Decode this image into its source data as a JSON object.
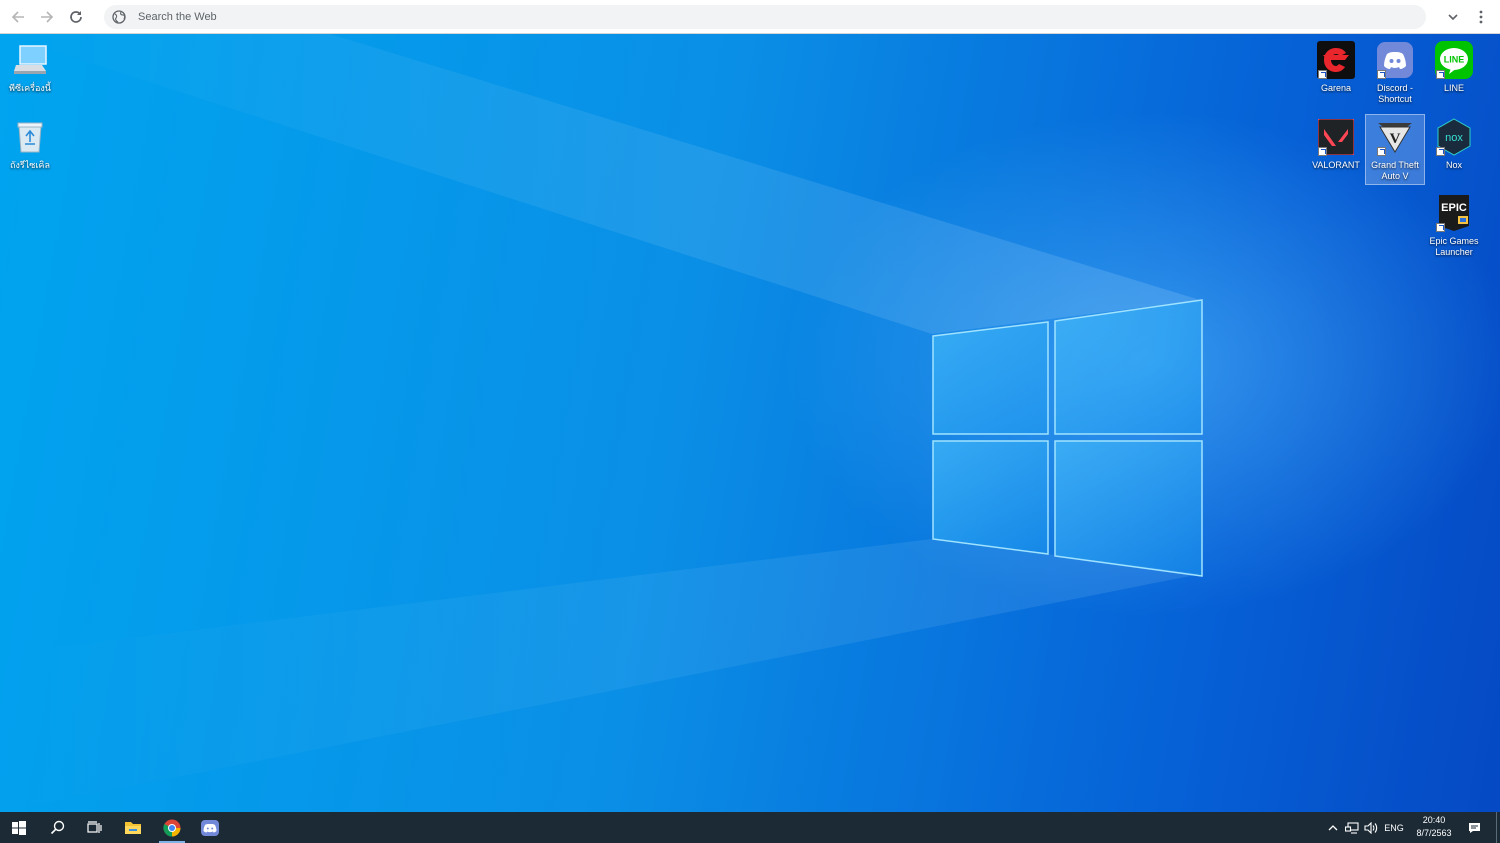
{
  "browser": {
    "omnibox_placeholder": "Search the Web",
    "icons": {
      "back": "arrow-left-icon",
      "forward": "arrow-right-icon",
      "reload": "reload-icon",
      "site_info": "globe-icon",
      "tab_search": "chevron-down-icon",
      "menu": "kebab-menu-icon"
    }
  },
  "desktop": {
    "left_icons": [
      {
        "label": "พีซีเครื่องนี้",
        "icon": "this-pc-icon"
      },
      {
        "label": "ถังรีไซเคิล",
        "icon": "recycle-bin-icon"
      }
    ],
    "right_icons": [
      {
        "label": "Garena",
        "icon": "garena-icon"
      },
      {
        "label": "Discord - Shortcut",
        "icon": "discord-icon"
      },
      {
        "label": "LINE",
        "icon": "line-icon",
        "badge": "LINE"
      },
      {
        "label": "VALORANT",
        "icon": "valorant-icon"
      },
      {
        "label": "Grand Theft Auto V",
        "icon": "gta-v-icon",
        "badge": "V",
        "selected": true
      },
      {
        "label": "Nox",
        "icon": "nox-icon",
        "badge": "nox"
      },
      {
        "label": "Epic Games Launcher",
        "icon": "epic-games-icon",
        "badge": "EPIC"
      }
    ]
  },
  "taskbar": {
    "items": [
      {
        "name": "start",
        "icon": "windows-start-icon"
      },
      {
        "name": "search",
        "icon": "search-icon"
      },
      {
        "name": "task-view",
        "icon": "task-view-icon"
      },
      {
        "name": "file-explorer",
        "icon": "folder-icon"
      },
      {
        "name": "chrome",
        "icon": "chrome-icon",
        "active": true
      },
      {
        "name": "discord",
        "icon": "discord-icon"
      }
    ],
    "tray": {
      "language": "ENG",
      "time": "20:40",
      "date": "8/7/2563",
      "icons": [
        "chevron-up-icon",
        "network-icon",
        "volume-icon",
        "notification-icon"
      ]
    }
  },
  "colors": {
    "desktop_light": "#00a4ef",
    "desktop_dark": "#0549c4",
    "taskbar": "#1b2a35",
    "omnibox": "#f1f3f4"
  }
}
